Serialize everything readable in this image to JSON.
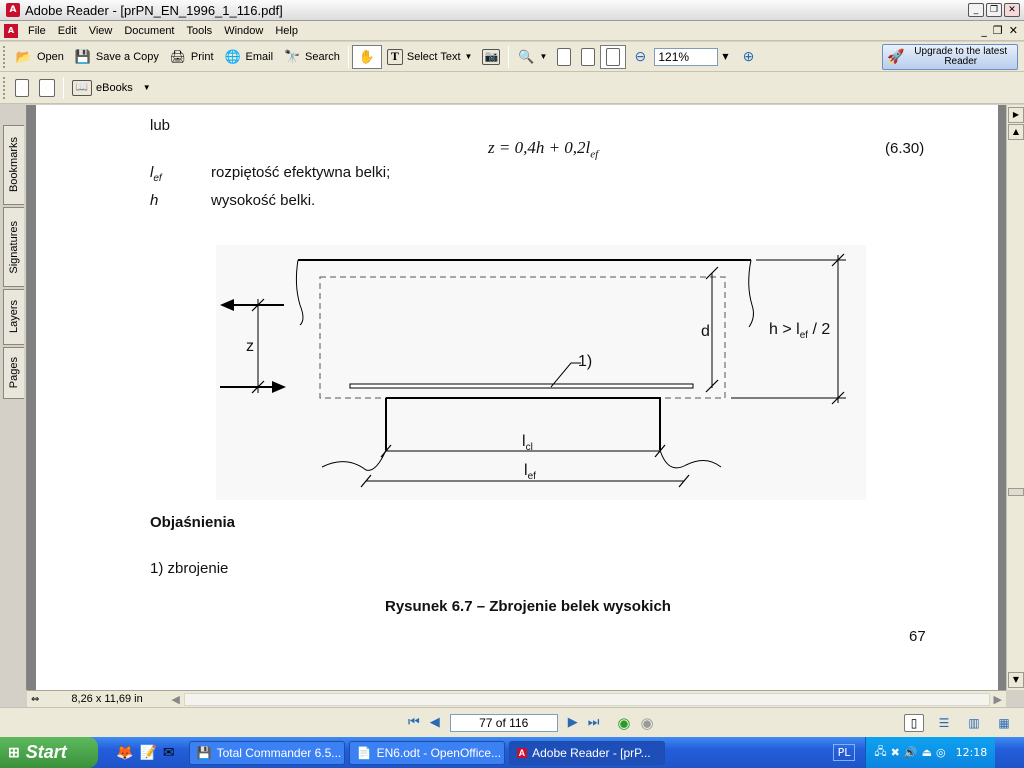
{
  "window": {
    "title": "Adobe Reader - [prPN_EN_1996_1_116.pdf]",
    "controls": [
      "_",
      "❐",
      "✕"
    ]
  },
  "menu": {
    "items": [
      "File",
      "Edit",
      "View",
      "Document",
      "Tools",
      "Window",
      "Help"
    ]
  },
  "toolbar1": {
    "open": "Open",
    "save_copy": "Save a Copy",
    "print": "Print",
    "email": "Email",
    "search": "Search",
    "select_text": "Select Text",
    "zoom_value": "121%",
    "upgrade": "Upgrade to the latest Reader"
  },
  "toolbar2": {
    "ebooks": "eBooks"
  },
  "nav_tabs": [
    "Bookmarks",
    "Signatures",
    "Layers",
    "Pages"
  ],
  "page": {
    "lub": "lub",
    "formula": "z = 0,4h + 0,2l",
    "formula_sub": "ef",
    "eq_number": "(6.30)",
    "def1_symbol": "l",
    "def1_sub": "ef",
    "def1_text": "rozpiętość efektywna belki;",
    "def2_symbol": "h",
    "def2_text": "wysokość belki.",
    "figure": {
      "label_z": "z",
      "label_d": "d",
      "label_h": "h > l",
      "label_h_sub": "ef",
      "label_h_suffix": " / 2",
      "label_1": "1)",
      "label_lcl": "l",
      "label_lcl_sub": "cl",
      "label_lef": "l",
      "label_lef_sub": "ef"
    },
    "explanations_title": "Objaśnienia",
    "explanation_1": "1)  zbrojenie",
    "caption": "Rysunek 6.7 – Zbrojenie belek wysokich",
    "page_number": "67"
  },
  "status": {
    "page_size": "8,26 x 11,69 in"
  },
  "navigation": {
    "page_field": "77 of 116"
  },
  "taskbar": {
    "start": "Start",
    "tasks": [
      "Total Commander 6.5...",
      "EN6.odt - OpenOffice...",
      "Adobe Reader - [prP..."
    ],
    "language": "PL",
    "clock": "12:18"
  }
}
